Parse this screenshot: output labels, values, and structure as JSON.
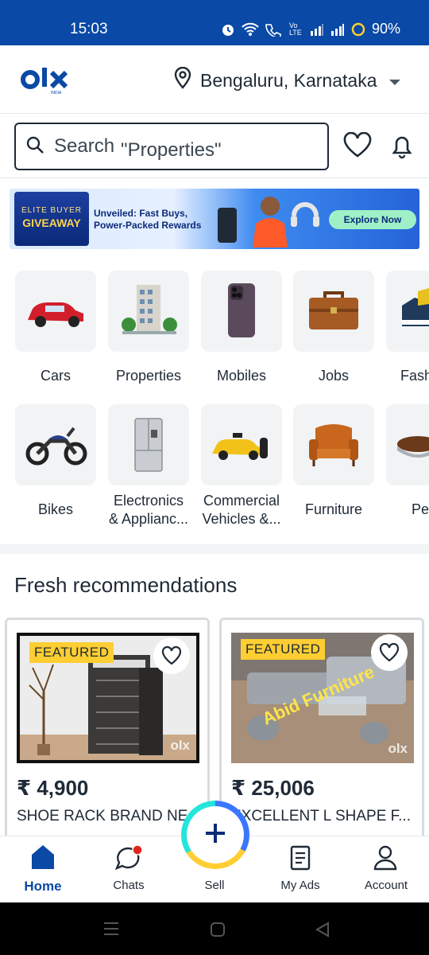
{
  "status_bar": {
    "time": "15:03",
    "battery": "90%",
    "network_label": "Vo LTE"
  },
  "header": {
    "logo_text": "olx",
    "location": "Bengaluru, Karnataka"
  },
  "search": {
    "placeholder_word": "Search",
    "placeholder_hint": "\"Properties\""
  },
  "banner": {
    "badge_top": "ELITE BUYER",
    "badge_main": "GIVEAWAY",
    "line1": "Unveiled: Fast Buys,",
    "line2": "Power-Packed Rewards",
    "cta": "Explore Now"
  },
  "categories_row1": [
    {
      "label": "Cars",
      "icon": "car-icon"
    },
    {
      "label": "Properties",
      "icon": "building-icon"
    },
    {
      "label": "Mobiles",
      "icon": "phone-icon"
    },
    {
      "label": "Jobs",
      "icon": "briefcase-icon"
    },
    {
      "label": "Fash",
      "icon": "shoe-icon"
    }
  ],
  "categories_row2": [
    {
      "label": "Bikes",
      "icon": "motorbike-icon"
    },
    {
      "label_line1": "Electronics",
      "label_line2": "& Applianc...",
      "icon": "fridge-icon"
    },
    {
      "label_line1": "Commercial",
      "label_line2": "Vehicles &...",
      "icon": "taxi-icon"
    },
    {
      "label": "Furniture",
      "icon": "armchair-icon"
    },
    {
      "label": "Pe",
      "icon": "pet-bowl-icon"
    }
  ],
  "section_title": "Fresh recommendations",
  "listings": [
    {
      "badge": "FEATURED",
      "price": "₹ 4,900",
      "title": "SHOE RACK BRAND NE",
      "watermark": "olx"
    },
    {
      "badge": "FEATURED",
      "price": "₹ 25,006",
      "title": "EXCELLENT L SHAPE F...",
      "watermark": "olx",
      "overlay_text": "Abid Furniture"
    }
  ],
  "bottom_nav": [
    {
      "label": "Home"
    },
    {
      "label": "Chats"
    },
    {
      "label": "Sell"
    },
    {
      "label": "My Ads"
    },
    {
      "label": "Account"
    }
  ],
  "colors": {
    "brand_blue": "#0a49a5",
    "featured_yellow": "#ffce32",
    "olx_teal": "#23e5db",
    "text_dark": "#1f2a36"
  }
}
